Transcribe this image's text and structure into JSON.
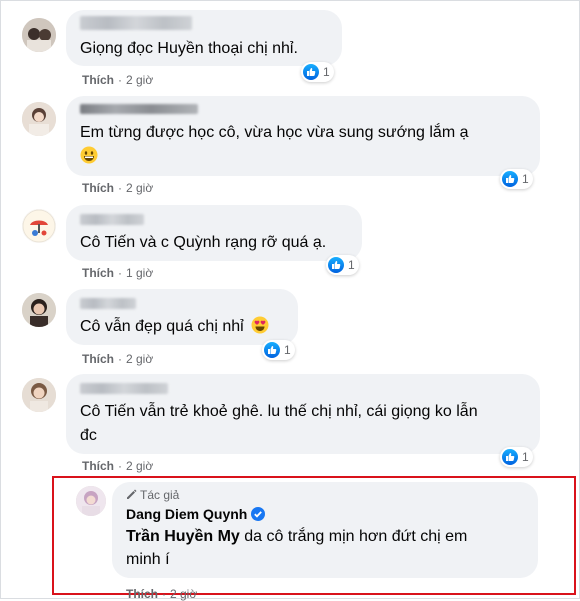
{
  "comments": [
    {
      "text": "Giọng đọc Huyền thoại chị nhỉ.",
      "like_label": "Thích",
      "time": "2 giờ",
      "reaction_count": "1"
    },
    {
      "name_partial": "Đinh Hoài Thư",
      "text": "Em từng được học cô, vừa học vừa sung sướng lắm ạ",
      "like_label": "Thích",
      "time": "2 giờ",
      "reaction_count": "1"
    },
    {
      "text": "Cô Tiến và c Quỳnh rạng rỡ quá ạ.",
      "like_label": "Thích",
      "time": "1 giờ",
      "reaction_count": "1"
    },
    {
      "text": "Cô vẫn đẹp quá chị nhỉ",
      "like_label": "Thích",
      "time": "2 giờ",
      "reaction_count": "1"
    },
    {
      "text_line1": "Cô Tiến vẫn trẻ khoẻ ghê. lu thế chị nhỉ, cái giọng ko lẫn",
      "text_line2": "đc",
      "like_label": "Thích",
      "time": "2 giờ",
      "reaction_count": "1"
    }
  ],
  "author_reply": {
    "tag": "Tác giả",
    "name": "Dang Diem Quynh",
    "mention": "Trần Huyền My",
    "text_line1": " da cô trắng mịn hơn đứt chị em",
    "text_line2": "minh í",
    "like_label": "Thích",
    "time": "2 giờ"
  },
  "colors": {
    "bubble": "#f0f2f5",
    "meta": "#65676b",
    "like_blue": "#1877f2",
    "highlight_border": "#d9121b"
  },
  "icons": [
    "like-icon",
    "pencil-icon",
    "verified-badge-icon",
    "grinning-emoji-icon",
    "heart-eyes-emoji-icon"
  ]
}
